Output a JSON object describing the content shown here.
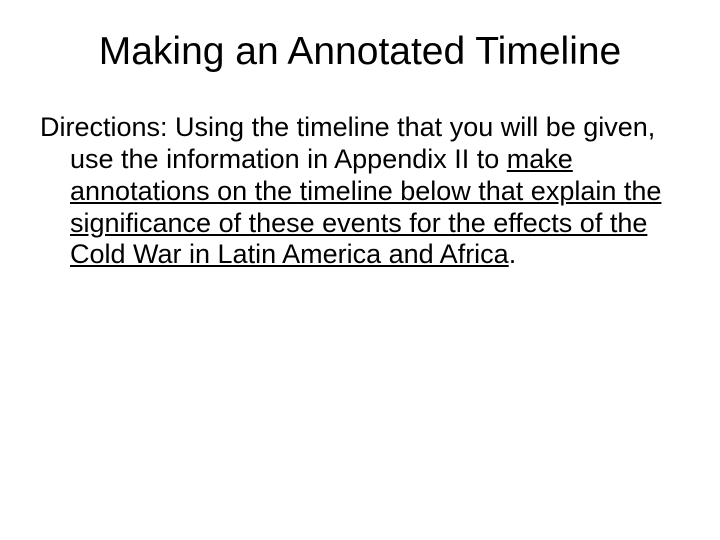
{
  "title": "Making an Annotated Timeline",
  "directions_label": "Directions:",
  "body_pre": " Using the timeline that you will be given, use the information in Appendix II to ",
  "body_underlined": "make annotations on the timeline below that explain the significance of these events for the effects of the Cold War in Latin America and Africa",
  "body_post": "."
}
